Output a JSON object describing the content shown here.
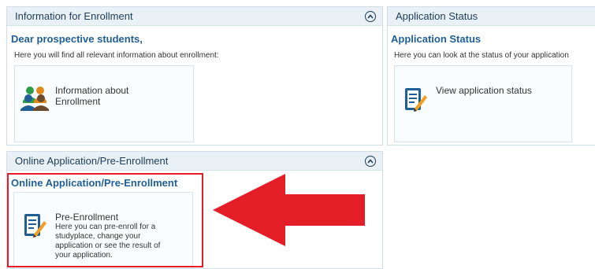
{
  "enrollment_info": {
    "header_title": "Information for Enrollment",
    "subtitle": "Dear prospective students,",
    "description": "Here you will find all relevant information about enrollment:",
    "tile": {
      "icon": "people-icon",
      "label_line1": "Information about",
      "label_line2": "Enrollment"
    }
  },
  "application_status": {
    "header_title": "Application Status",
    "subtitle": "Application Status",
    "description": "Here you can look at the status of your application",
    "tile": {
      "icon": "edit-document-icon",
      "label": "View application status"
    }
  },
  "online_application": {
    "header_title": "Online Application/Pre-Enrollment",
    "subtitle": "Online Application/Pre-Enrollment",
    "tile": {
      "icon": "edit-document-icon",
      "label": "Pre-Enrollment",
      "desc_lines": [
        "Here you can pre-enroll for a",
        "studyplace, change your",
        "application or see the result of",
        "your application."
      ]
    }
  },
  "colors": {
    "highlight": "#e41e26",
    "subtitle": "#1f5f96",
    "header_bg": "#e9f1f6"
  }
}
